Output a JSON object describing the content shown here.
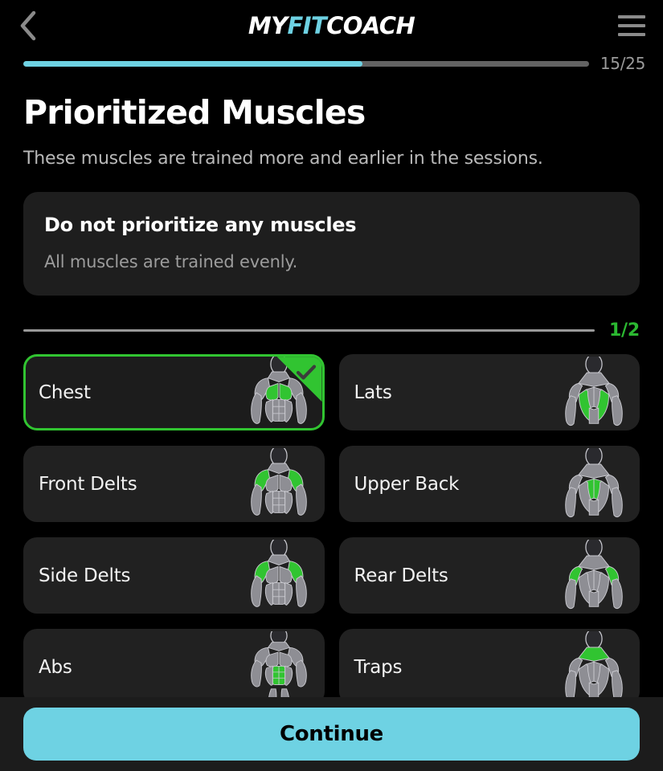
{
  "header": {
    "back_icon": "chevron-left-icon",
    "menu_icon": "hamburger-menu-icon",
    "logo_part1": "MY",
    "logo_part2": "FIT",
    "logo_part3": "COACH",
    "logo_accent_color": "#6ed2e3"
  },
  "progress": {
    "label": "15/25",
    "current": 15,
    "total": 25,
    "percent": 60,
    "fill_color": "#6ed2e3",
    "track_color": "#636363"
  },
  "main": {
    "title": "Prioritized Muscles",
    "subtitle": "These muscles are trained more and earlier in the sessions."
  },
  "notice": {
    "title": "Do not prioritize any muscles",
    "subtitle": "All muscles are trained evenly."
  },
  "divider": {
    "count_label": "1/2",
    "count_color": "#2bb831",
    "selected": 1,
    "max": 2
  },
  "muscles": [
    {
      "label": "Chest",
      "view": "front",
      "region": "chest",
      "selected": true
    },
    {
      "label": "Lats",
      "view": "back",
      "region": "lats",
      "selected": false
    },
    {
      "label": "Front Delts",
      "view": "front",
      "region": "frontdelt",
      "selected": false
    },
    {
      "label": "Upper Back",
      "view": "back",
      "region": "upperback",
      "selected": false
    },
    {
      "label": "Side Delts",
      "view": "front",
      "region": "sidedelt",
      "selected": false
    },
    {
      "label": "Rear Delts",
      "view": "back",
      "region": "reardelt",
      "selected": false
    },
    {
      "label": "Abs",
      "view": "full",
      "region": "abs",
      "selected": false
    },
    {
      "label": "Traps",
      "view": "back",
      "region": "traps",
      "selected": false
    }
  ],
  "footer": {
    "continue_label": "Continue",
    "button_color": "#6ed2e3"
  },
  "theme": {
    "background": "#000000",
    "card": "#212121",
    "accent_green": "#31c431",
    "accent_cyan": "#6ed2e3",
    "muscle_gray": "#8e8e94",
    "muscle_highlight": "#31c431"
  },
  "check_icon": "check-icon"
}
